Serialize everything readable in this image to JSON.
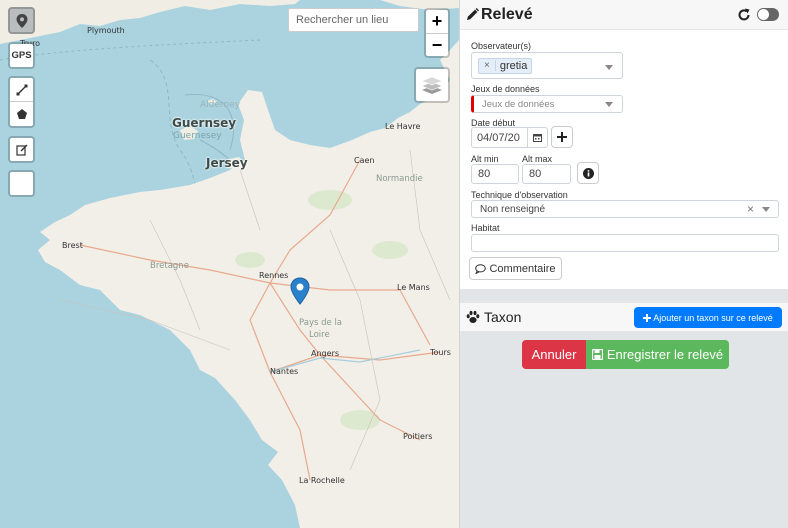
{
  "map": {
    "search_placeholder": "Rechercher un lieu",
    "zoom_in": "+",
    "zoom_out": "−",
    "gps_label": "GPS",
    "places": {
      "plymouth": "Plymouth",
      "truro": "Truro",
      "alderney": "Alderney",
      "guernsey": "Guernsey",
      "guernesey": "Guernesey",
      "jersey": "Jersey",
      "le_havre": "Le Havre",
      "caen": "Caen",
      "normandie": "Normandie",
      "brest": "Brest",
      "bretagne": "Bretagne",
      "rennes": "Rennes",
      "le_mans": "Le Mans",
      "pays_de_la": "Pays de la",
      "loire": "Loire",
      "angers": "Angers",
      "tours": "Tours",
      "nantes": "Nantes",
      "poitiers": "Poitiers",
      "la_rochelle": "La Rochelle"
    }
  },
  "releve": {
    "title": "Relevé",
    "observers_label": "Observateur(s)",
    "observer_tag": "gretia",
    "observer_tag_remove": "×",
    "datasets_label": "Jeux de données",
    "datasets_placeholder": "Jeux de données",
    "date_label": "Date début",
    "date_value": "04/07/20",
    "alt_min_label": "Alt min",
    "alt_min_value": "80",
    "alt_max_label": "Alt max",
    "alt_max_value": "80",
    "technique_label": "Technique d'observation",
    "technique_value": "Non renseigné",
    "technique_clear": "×",
    "habitat_label": "Habitat",
    "habitat_value": "",
    "comment_button": "Commentaire"
  },
  "taxon": {
    "title": "Taxon",
    "add_button": "Ajouter un taxon sur ce relevé"
  },
  "actions": {
    "cancel": "Annuler",
    "save": "Enregistrer le relevé"
  },
  "colors": {
    "primary": "#007bff",
    "danger": "#dc3545",
    "success": "#5cb85c",
    "required": "#e00000",
    "sea": "#aad3df",
    "land": "#f2efe9"
  }
}
